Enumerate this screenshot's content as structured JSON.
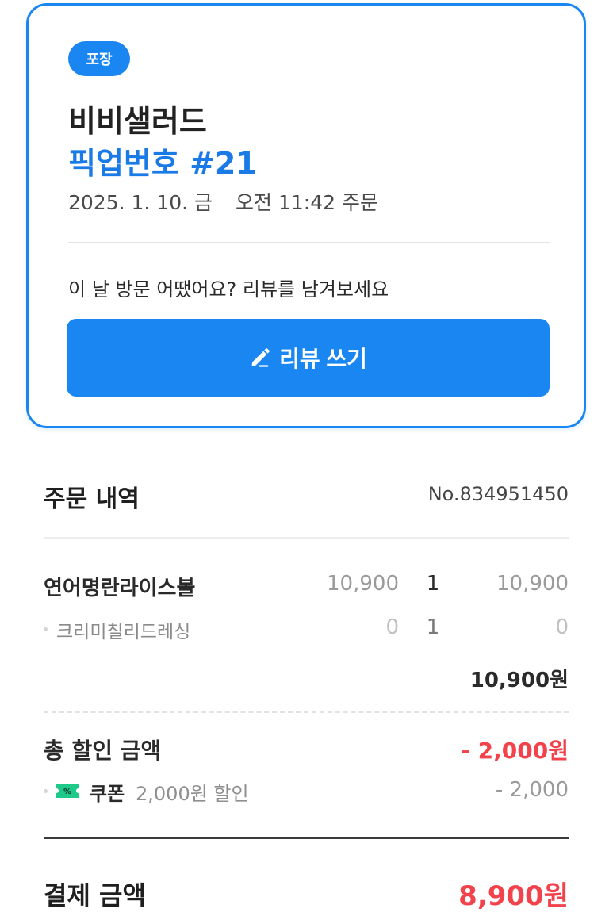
{
  "order_card": {
    "badge": "포장",
    "store_name": "비비샐러드",
    "pickup_number": "픽업번호 #21",
    "date": "2025. 1. 10. 금",
    "time": "오전 11:42 주문",
    "review_prompt": "이 날 방문 어땠어요? 리뷰를 남겨보세요",
    "review_button": "리뷰 쓰기"
  },
  "order_details": {
    "title": "주문 내역",
    "order_number": "No.834951450",
    "items": [
      {
        "name": "연어명란라이스볼",
        "unit_price": "10,900",
        "qty": "1",
        "total": "10,900"
      },
      {
        "name": "크리미칠리드레싱",
        "unit_price": "0",
        "qty": "1",
        "total": "0"
      }
    ],
    "subtotal": "10,900원"
  },
  "discount": {
    "label": "총 할인 금액",
    "value": "- 2,000원",
    "coupon_label": "쿠폰",
    "coupon_desc": "2,000원 할인",
    "coupon_amount": "- 2,000"
  },
  "payment": {
    "label": "결제 금액",
    "value": "8,900원"
  },
  "colors": {
    "accent": "#1a86f2",
    "discount_red": "#f2434c",
    "coupon_green": "#1ec98a"
  }
}
